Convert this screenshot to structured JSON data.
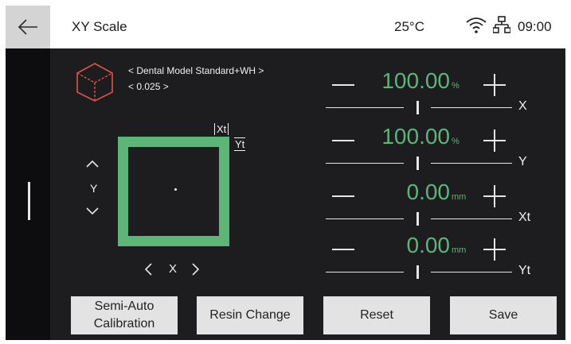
{
  "header": {
    "title": "XY Scale",
    "temperature": "25°C",
    "time": "09:00"
  },
  "model": {
    "name": "< Dental Model Standard+WH >",
    "layer": "< 0.025 >"
  },
  "preview": {
    "xt_label": "Xt",
    "yt_label": "Yt",
    "y_axis_label": "Y",
    "x_axis_label": "X"
  },
  "params": [
    {
      "value": "100.00",
      "unit": "%",
      "axis": "X"
    },
    {
      "value": "100.00",
      "unit": "%",
      "axis": "Y"
    },
    {
      "value": "0.00",
      "unit": "mm",
      "axis": "Xt"
    },
    {
      "value": "0.00",
      "unit": "mm",
      "axis": "Yt"
    }
  ],
  "buttons": {
    "calibration": "Semi-Auto Calibration",
    "resin_change": "Resin Change",
    "reset": "Reset",
    "save": "Save"
  },
  "colors": {
    "accent": "#5cb579",
    "background": "#1d1d1f",
    "button": "#e3e3e3"
  }
}
